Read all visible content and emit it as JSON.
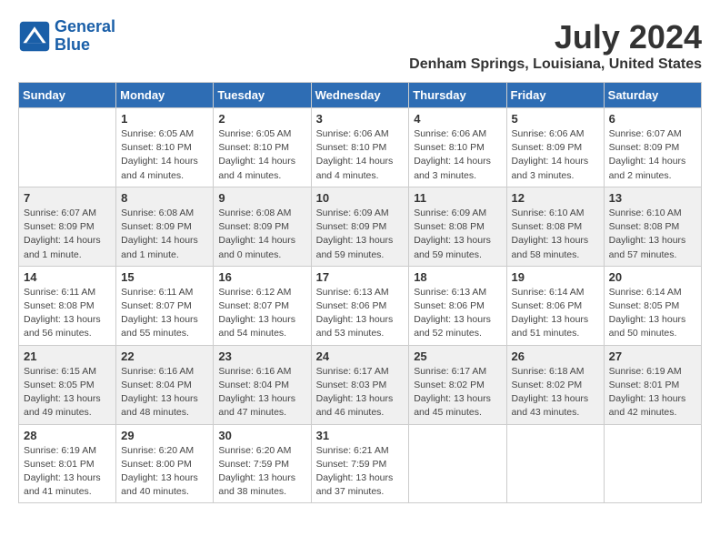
{
  "logo": {
    "line1": "General",
    "line2": "Blue"
  },
  "title": "July 2024",
  "subtitle": "Denham Springs, Louisiana, United States",
  "days_of_week": [
    "Sunday",
    "Monday",
    "Tuesday",
    "Wednesday",
    "Thursday",
    "Friday",
    "Saturday"
  ],
  "weeks": [
    [
      {
        "day": "",
        "sunrise": "",
        "sunset": "",
        "daylight": ""
      },
      {
        "day": "1",
        "sunrise": "Sunrise: 6:05 AM",
        "sunset": "Sunset: 8:10 PM",
        "daylight": "Daylight: 14 hours and 4 minutes."
      },
      {
        "day": "2",
        "sunrise": "Sunrise: 6:05 AM",
        "sunset": "Sunset: 8:10 PM",
        "daylight": "Daylight: 14 hours and 4 minutes."
      },
      {
        "day": "3",
        "sunrise": "Sunrise: 6:06 AM",
        "sunset": "Sunset: 8:10 PM",
        "daylight": "Daylight: 14 hours and 4 minutes."
      },
      {
        "day": "4",
        "sunrise": "Sunrise: 6:06 AM",
        "sunset": "Sunset: 8:10 PM",
        "daylight": "Daylight: 14 hours and 3 minutes."
      },
      {
        "day": "5",
        "sunrise": "Sunrise: 6:06 AM",
        "sunset": "Sunset: 8:09 PM",
        "daylight": "Daylight: 14 hours and 3 minutes."
      },
      {
        "day": "6",
        "sunrise": "Sunrise: 6:07 AM",
        "sunset": "Sunset: 8:09 PM",
        "daylight": "Daylight: 14 hours and 2 minutes."
      }
    ],
    [
      {
        "day": "7",
        "sunrise": "Sunrise: 6:07 AM",
        "sunset": "Sunset: 8:09 PM",
        "daylight": "Daylight: 14 hours and 1 minute."
      },
      {
        "day": "8",
        "sunrise": "Sunrise: 6:08 AM",
        "sunset": "Sunset: 8:09 PM",
        "daylight": "Daylight: 14 hours and 1 minute."
      },
      {
        "day": "9",
        "sunrise": "Sunrise: 6:08 AM",
        "sunset": "Sunset: 8:09 PM",
        "daylight": "Daylight: 14 hours and 0 minutes."
      },
      {
        "day": "10",
        "sunrise": "Sunrise: 6:09 AM",
        "sunset": "Sunset: 8:09 PM",
        "daylight": "Daylight: 13 hours and 59 minutes."
      },
      {
        "day": "11",
        "sunrise": "Sunrise: 6:09 AM",
        "sunset": "Sunset: 8:08 PM",
        "daylight": "Daylight: 13 hours and 59 minutes."
      },
      {
        "day": "12",
        "sunrise": "Sunrise: 6:10 AM",
        "sunset": "Sunset: 8:08 PM",
        "daylight": "Daylight: 13 hours and 58 minutes."
      },
      {
        "day": "13",
        "sunrise": "Sunrise: 6:10 AM",
        "sunset": "Sunset: 8:08 PM",
        "daylight": "Daylight: 13 hours and 57 minutes."
      }
    ],
    [
      {
        "day": "14",
        "sunrise": "Sunrise: 6:11 AM",
        "sunset": "Sunset: 8:08 PM",
        "daylight": "Daylight: 13 hours and 56 minutes."
      },
      {
        "day": "15",
        "sunrise": "Sunrise: 6:11 AM",
        "sunset": "Sunset: 8:07 PM",
        "daylight": "Daylight: 13 hours and 55 minutes."
      },
      {
        "day": "16",
        "sunrise": "Sunrise: 6:12 AM",
        "sunset": "Sunset: 8:07 PM",
        "daylight": "Daylight: 13 hours and 54 minutes."
      },
      {
        "day": "17",
        "sunrise": "Sunrise: 6:13 AM",
        "sunset": "Sunset: 8:06 PM",
        "daylight": "Daylight: 13 hours and 53 minutes."
      },
      {
        "day": "18",
        "sunrise": "Sunrise: 6:13 AM",
        "sunset": "Sunset: 8:06 PM",
        "daylight": "Daylight: 13 hours and 52 minutes."
      },
      {
        "day": "19",
        "sunrise": "Sunrise: 6:14 AM",
        "sunset": "Sunset: 8:06 PM",
        "daylight": "Daylight: 13 hours and 51 minutes."
      },
      {
        "day": "20",
        "sunrise": "Sunrise: 6:14 AM",
        "sunset": "Sunset: 8:05 PM",
        "daylight": "Daylight: 13 hours and 50 minutes."
      }
    ],
    [
      {
        "day": "21",
        "sunrise": "Sunrise: 6:15 AM",
        "sunset": "Sunset: 8:05 PM",
        "daylight": "Daylight: 13 hours and 49 minutes."
      },
      {
        "day": "22",
        "sunrise": "Sunrise: 6:16 AM",
        "sunset": "Sunset: 8:04 PM",
        "daylight": "Daylight: 13 hours and 48 minutes."
      },
      {
        "day": "23",
        "sunrise": "Sunrise: 6:16 AM",
        "sunset": "Sunset: 8:04 PM",
        "daylight": "Daylight: 13 hours and 47 minutes."
      },
      {
        "day": "24",
        "sunrise": "Sunrise: 6:17 AM",
        "sunset": "Sunset: 8:03 PM",
        "daylight": "Daylight: 13 hours and 46 minutes."
      },
      {
        "day": "25",
        "sunrise": "Sunrise: 6:17 AM",
        "sunset": "Sunset: 8:02 PM",
        "daylight": "Daylight: 13 hours and 45 minutes."
      },
      {
        "day": "26",
        "sunrise": "Sunrise: 6:18 AM",
        "sunset": "Sunset: 8:02 PM",
        "daylight": "Daylight: 13 hours and 43 minutes."
      },
      {
        "day": "27",
        "sunrise": "Sunrise: 6:19 AM",
        "sunset": "Sunset: 8:01 PM",
        "daylight": "Daylight: 13 hours and 42 minutes."
      }
    ],
    [
      {
        "day": "28",
        "sunrise": "Sunrise: 6:19 AM",
        "sunset": "Sunset: 8:01 PM",
        "daylight": "Daylight: 13 hours and 41 minutes."
      },
      {
        "day": "29",
        "sunrise": "Sunrise: 6:20 AM",
        "sunset": "Sunset: 8:00 PM",
        "daylight": "Daylight: 13 hours and 40 minutes."
      },
      {
        "day": "30",
        "sunrise": "Sunrise: 6:20 AM",
        "sunset": "Sunset: 7:59 PM",
        "daylight": "Daylight: 13 hours and 38 minutes."
      },
      {
        "day": "31",
        "sunrise": "Sunrise: 6:21 AM",
        "sunset": "Sunset: 7:59 PM",
        "daylight": "Daylight: 13 hours and 37 minutes."
      },
      {
        "day": "",
        "sunrise": "",
        "sunset": "",
        "daylight": ""
      },
      {
        "day": "",
        "sunrise": "",
        "sunset": "",
        "daylight": ""
      },
      {
        "day": "",
        "sunrise": "",
        "sunset": "",
        "daylight": ""
      }
    ]
  ]
}
